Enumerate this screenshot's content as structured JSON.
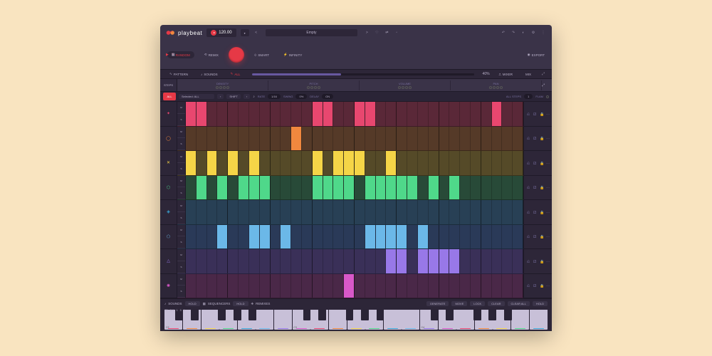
{
  "app": {
    "name": "playbeat"
  },
  "header": {
    "tempo": "120.00",
    "preset_prev": "<",
    "preset_name": "Empty",
    "preset_next": ">"
  },
  "modes": {
    "play_icon": "play",
    "grid_icon": "grid",
    "random": "RANDOM",
    "remix": "REMIX",
    "smart": "SMART",
    "infinity": "INFINITY",
    "export": "EXPORT"
  },
  "tabs": {
    "pattern": "PATTERN",
    "sounds": "SOUNDS",
    "all": "ALL",
    "progress": "40%",
    "mixer": "MIXER",
    "mix": "MIX"
  },
  "params": {
    "steps": "STEPS",
    "density": "DENSITY",
    "pitch": "PITCH",
    "volume": "VOLUME",
    "pan": "PAN"
  },
  "ctrl": {
    "all": "ALL",
    "selected": "Selected: ALL",
    "shift": "SHIFT",
    "rate_l": "RATE",
    "rate_v": "1/16",
    "swing_l": "SWING",
    "swing_v": "0%",
    "delay_l": "DELAY",
    "delay_v": "ON",
    "allsteps": "ALL STEPS",
    "one": "1",
    "flam": "FLAM"
  },
  "tracks": [
    {
      "color": "#e8476f",
      "bg": "#5a2838",
      "icon": "star",
      "steps": [
        1,
        1,
        0,
        0,
        0,
        0,
        0,
        0,
        0,
        0,
        0,
        0,
        1,
        1,
        0,
        0,
        1,
        1,
        0,
        0,
        0,
        0,
        0,
        0,
        0,
        0,
        0,
        0,
        0,
        1,
        0,
        0
      ]
    },
    {
      "color": "#f0883e",
      "bg": "#553a28",
      "icon": "circle",
      "steps": [
        0,
        0,
        0,
        0,
        0,
        0,
        0,
        0,
        0,
        0,
        1,
        0,
        0,
        0,
        0,
        0,
        0,
        0,
        0,
        0,
        0,
        0,
        0,
        0,
        0,
        0,
        0,
        0,
        0,
        0,
        0,
        0
      ]
    },
    {
      "color": "#f5d547",
      "bg": "#554a28",
      "icon": "cross",
      "steps": [
        1,
        0,
        1,
        0,
        1,
        0,
        1,
        0,
        0,
        0,
        0,
        0,
        1,
        0,
        1,
        1,
        1,
        0,
        0,
        1,
        0,
        0,
        0,
        0,
        0,
        0,
        0,
        0,
        0,
        0,
        0,
        0
      ]
    },
    {
      "color": "#4fd88a",
      "bg": "#284a38",
      "icon": "hex",
      "steps": [
        0,
        1,
        0,
        1,
        0,
        1,
        1,
        1,
        0,
        0,
        0,
        0,
        1,
        1,
        1,
        1,
        0,
        1,
        1,
        1,
        1,
        1,
        0,
        1,
        0,
        1,
        0,
        0,
        0,
        0,
        0,
        0
      ]
    },
    {
      "color": "#3aa8d8",
      "bg": "#284055",
      "icon": "dia",
      "steps": [
        0,
        0,
        0,
        0,
        0,
        0,
        0,
        0,
        0,
        0,
        0,
        0,
        0,
        0,
        0,
        0,
        0,
        0,
        0,
        0,
        0,
        0,
        0,
        0,
        0,
        0,
        0,
        0,
        0,
        0,
        0,
        0
      ]
    },
    {
      "color": "#6bb8e8",
      "bg": "#2a3a58",
      "icon": "pent",
      "steps": [
        0,
        0,
        0,
        1,
        0,
        0,
        1,
        1,
        0,
        1,
        0,
        0,
        0,
        0,
        0,
        0,
        0,
        1,
        1,
        1,
        1,
        0,
        1,
        0,
        0,
        0,
        0,
        0,
        0,
        0,
        0,
        0
      ]
    },
    {
      "color": "#9878e8",
      "bg": "#3a3058",
      "icon": "tri",
      "steps": [
        0,
        0,
        0,
        0,
        0,
        0,
        0,
        0,
        0,
        0,
        0,
        0,
        0,
        0,
        0,
        0,
        0,
        0,
        0,
        1,
        1,
        0,
        1,
        1,
        1,
        1,
        0,
        0,
        0,
        0,
        0,
        0
      ]
    },
    {
      "color": "#d858c8",
      "bg": "#4a2848",
      "icon": "spark",
      "steps": [
        0,
        0,
        0,
        0,
        0,
        0,
        0,
        0,
        0,
        0,
        0,
        0,
        0,
        0,
        0,
        1,
        0,
        0,
        0,
        0,
        0,
        0,
        0,
        0,
        0,
        0,
        0,
        0,
        0,
        0,
        0,
        0
      ]
    }
  ],
  "rowlabels": [
    "M",
    "S"
  ],
  "footer": {
    "sounds": "SOUNDS",
    "hold": "HOLD",
    "sequencers": "SEQUENCERS",
    "remixes": "REMIXES",
    "generate": "GENERATE",
    "move": "MOVE",
    "lock": "LOCK",
    "clear": "CLEAR",
    "clearall": "CLEAR ALL"
  },
  "keyboard": {
    "octaves": [
      "C2",
      "C3",
      "C4"
    ],
    "labels": [
      "C2",
      "ALL",
      "1",
      "3",
      "4"
    ]
  },
  "track_colors": [
    "#e8476f",
    "#f0883e",
    "#f5d547",
    "#4fd88a",
    "#3aa8d8",
    "#6bb8e8",
    "#9878e8",
    "#d858c8"
  ]
}
